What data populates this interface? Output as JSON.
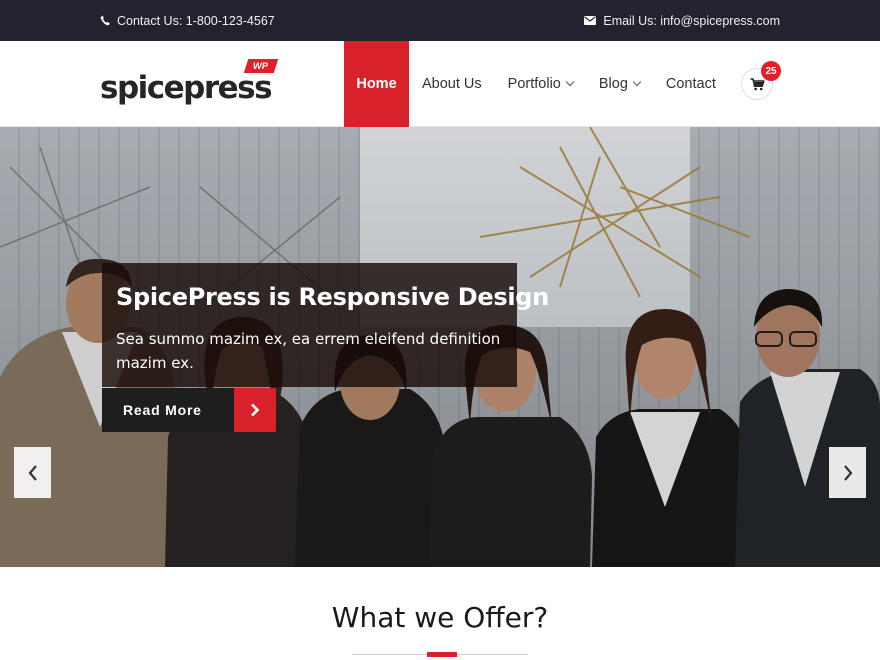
{
  "topbar": {
    "phone_icon": "phone-icon",
    "phone_text": "Contact Us: 1-800-123-4567",
    "email_icon": "envelope-icon",
    "email_text": "Email Us: info@spicepress.com"
  },
  "header": {
    "logo_text": "spicepress",
    "logo_badge": "WP",
    "nav": [
      {
        "label": "Home",
        "active": true
      },
      {
        "label": "About Us"
      },
      {
        "label": "Portfolio",
        "has_dropdown": true
      },
      {
        "label": "Blog",
        "has_dropdown": true
      },
      {
        "label": "Contact"
      }
    ],
    "cart_icon": "cart-icon",
    "cart_count": "25"
  },
  "hero": {
    "title": "SpicePress is Responsive Design",
    "text": "Sea summo mazim ex, ea errem eleifend definition mazim ex.",
    "button_label": "Read More",
    "button_icon": "chevron-right-icon",
    "prev_icon": "chevron-left-icon",
    "next_icon": "chevron-right-icon"
  },
  "section": {
    "title": "What we Offer?"
  },
  "colors": {
    "accent": "#d9212b",
    "topbar": "#22232f",
    "button_dark": "#1e1e1e"
  }
}
